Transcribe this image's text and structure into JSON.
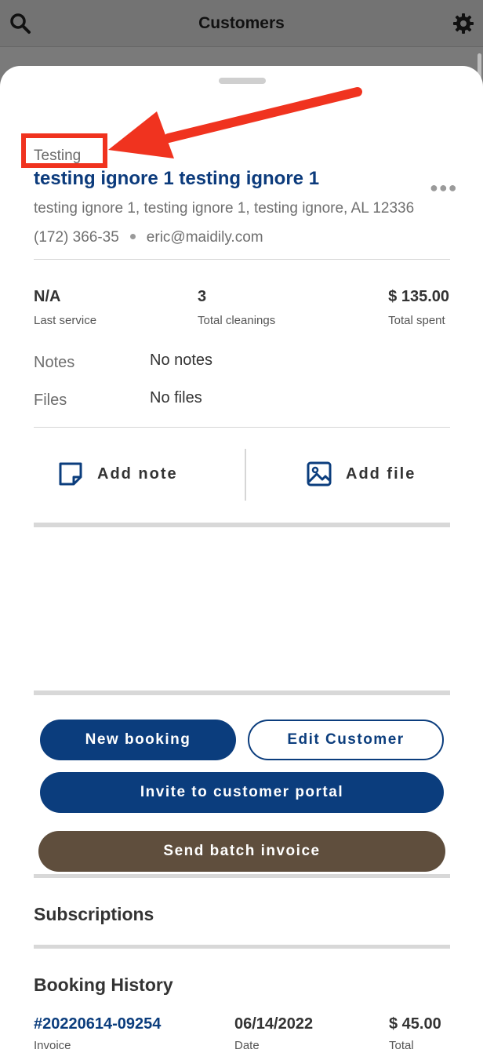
{
  "header": {
    "title": "Customers",
    "search_icon": "search-icon",
    "settings_icon": "gear-icon"
  },
  "customer": {
    "tag": "Testing",
    "name": "testing ignore 1 testing ignore 1",
    "address": "testing ignore 1, testing ignore 1, testing ignore, AL 12336",
    "phone": "(172) 366-35",
    "email": "eric@maidily.com"
  },
  "stats": [
    {
      "value": "N/A",
      "label": "Last service"
    },
    {
      "value": "3",
      "label": "Total cleanings"
    },
    {
      "value": "$ 135.00",
      "label": "Total spent"
    }
  ],
  "details": {
    "notes_label": "Notes",
    "notes_value": "No notes",
    "files_label": "Files",
    "files_value": "No files"
  },
  "actions": {
    "add_note": "Add note",
    "add_file": "Add file"
  },
  "buttons": {
    "new_booking": "New booking",
    "edit_customer": "Edit Customer",
    "invite_portal": "Invite to customer portal",
    "send_batch_invoice": "Send batch invoice"
  },
  "sections": {
    "subscriptions": "Subscriptions",
    "booking_history": "Booking History"
  },
  "booking_history": {
    "columns": [
      "Invoice",
      "Date",
      "Total"
    ],
    "rows": [
      {
        "invoice": "#20220614-09254",
        "date": "06/14/2022",
        "total": "$ 45.00"
      }
    ]
  },
  "colors": {
    "primary": "#0b3d7d",
    "brown": "#5f4e3d",
    "annotation_red": "#f0331f"
  }
}
